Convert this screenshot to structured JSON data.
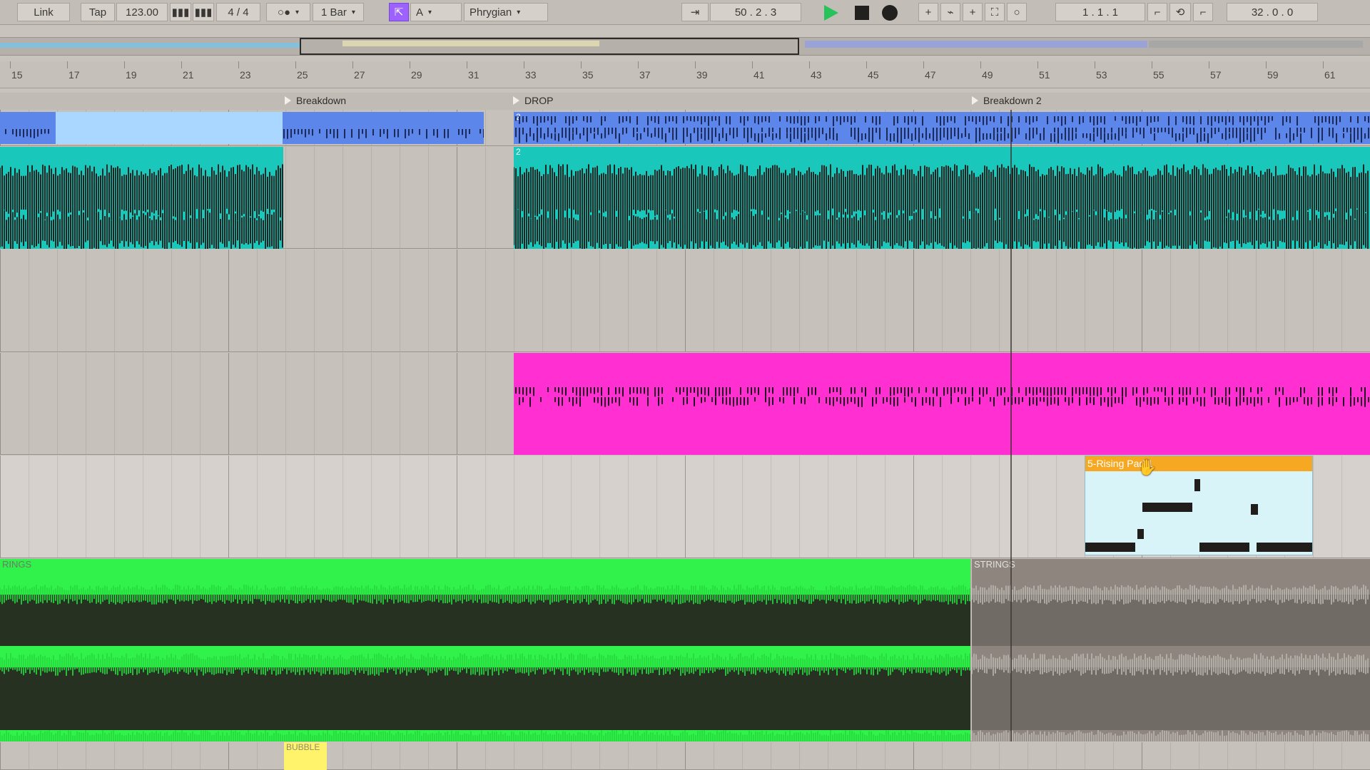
{
  "transport": {
    "link": "Link",
    "tap": "Tap",
    "tempo": "123.00",
    "signature": "4 / 4",
    "metronome": "○●",
    "quantize": "1 Bar",
    "key": "A",
    "scale": "Phrygian",
    "position": "50 .  2 .  3",
    "loop_start": "1 .  1 .  1",
    "loop_length": "32 .  0 .  0"
  },
  "ruler": {
    "bars": [
      "15",
      "17",
      "19",
      "21",
      "23",
      "25",
      "27",
      "29",
      "31",
      "33",
      "35",
      "37",
      "39",
      "41",
      "43",
      "45",
      "47",
      "49",
      "51",
      "53",
      "55",
      "57",
      "59",
      "61"
    ]
  },
  "locators": [
    {
      "label": "Breakdown"
    },
    {
      "label": "DROP"
    },
    {
      "label": "Breakdown 2"
    }
  ],
  "clips": {
    "midi_clip_number": "2",
    "audio_clip_number": "2",
    "rising_pad": "5-Rising  Pad 1",
    "strings_left": "RINGS",
    "strings_right": "STRINGS",
    "bubble": "BUBBLE"
  },
  "colors": {
    "blue": "#5d86ea",
    "teal": "#19c8bb",
    "magenta": "#ff2fd1",
    "orange": "#f6a823",
    "green": "#31f24a",
    "yellow": "#fff36c"
  }
}
